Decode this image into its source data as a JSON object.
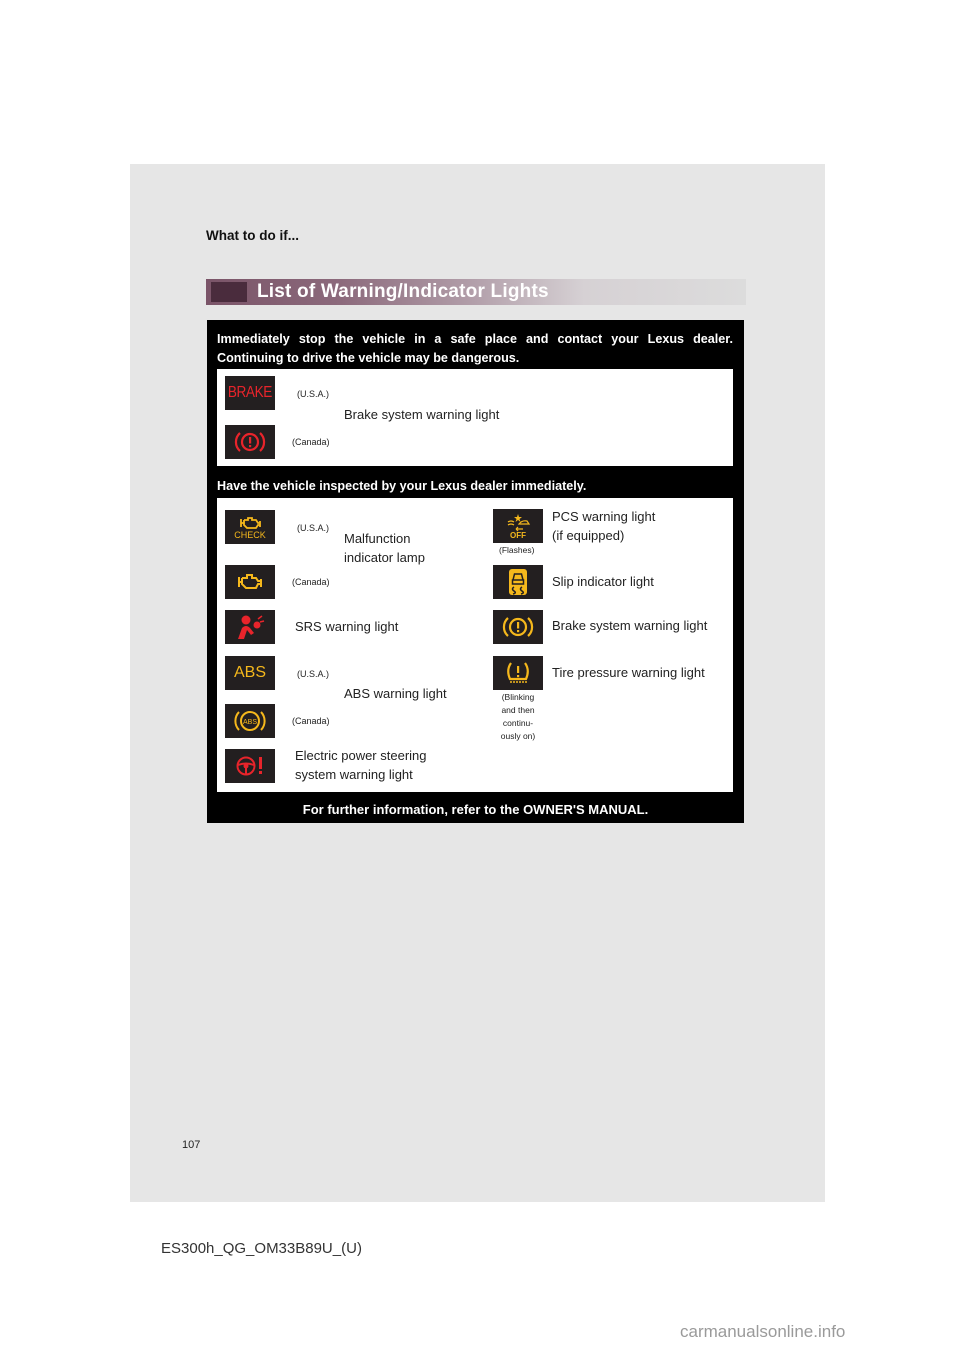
{
  "header": {
    "section": "What to do if..."
  },
  "title": "List of Warning/Indicator Lights",
  "colors": {
    "red": "#e8242b",
    "amber": "#f5b81c",
    "icon_bg": "#231f20",
    "title_bar": "#7a5468"
  },
  "group1": {
    "heading_line1": "Immediately stop the vehicle in a safe place and contact your Lexus dealer.",
    "heading_line2": "Continuing to drive the vehicle may be dangerous.",
    "items": [
      {
        "icon": "brake-text-icon",
        "icon_text": "BRAKE",
        "region": "(U.S.A.)"
      },
      {
        "icon": "brake-circle-icon",
        "region": "(Canada)"
      }
    ],
    "label": "Brake system warning light"
  },
  "group2": {
    "heading": "Have the vehicle inspected by your Lexus dealer immediately.",
    "malfunction": {
      "usa_icon_text": "CHECK",
      "usa_region": "(U.S.A.)",
      "canada_region": "(Canada)",
      "label_line1": "Malfunction",
      "label_line2": "indicator lamp"
    },
    "pcs": {
      "icon_text": "OFF",
      "note": "(Flashes)",
      "label_line1": "PCS warning light",
      "label_line2": "(if equipped)"
    },
    "slip": {
      "label": "Slip indicator light"
    },
    "srs": {
      "label": "SRS warning light"
    },
    "brake": {
      "label": "Brake system warning light"
    },
    "abs": {
      "usa_icon_text": "ABS",
      "canada_icon_text": "ABS",
      "usa_region": "(U.S.A.)",
      "canada_region": "(Canada)",
      "label": "ABS warning light"
    },
    "tire": {
      "label": "Tire pressure warning light",
      "note_line1": "(Blinking",
      "note_line2": "and then",
      "note_line3": "continu-",
      "note_line4": "ously on)"
    },
    "eps": {
      "label_line1": "Electric power steering",
      "label_line2": "system warning light"
    }
  },
  "footer_note": "For further information, refer to the OWNER'S MANUAL.",
  "page_number": "107",
  "doc_code": "ES300h_QG_OM33B89U_(U)",
  "watermark": "carmanualsonline.info"
}
